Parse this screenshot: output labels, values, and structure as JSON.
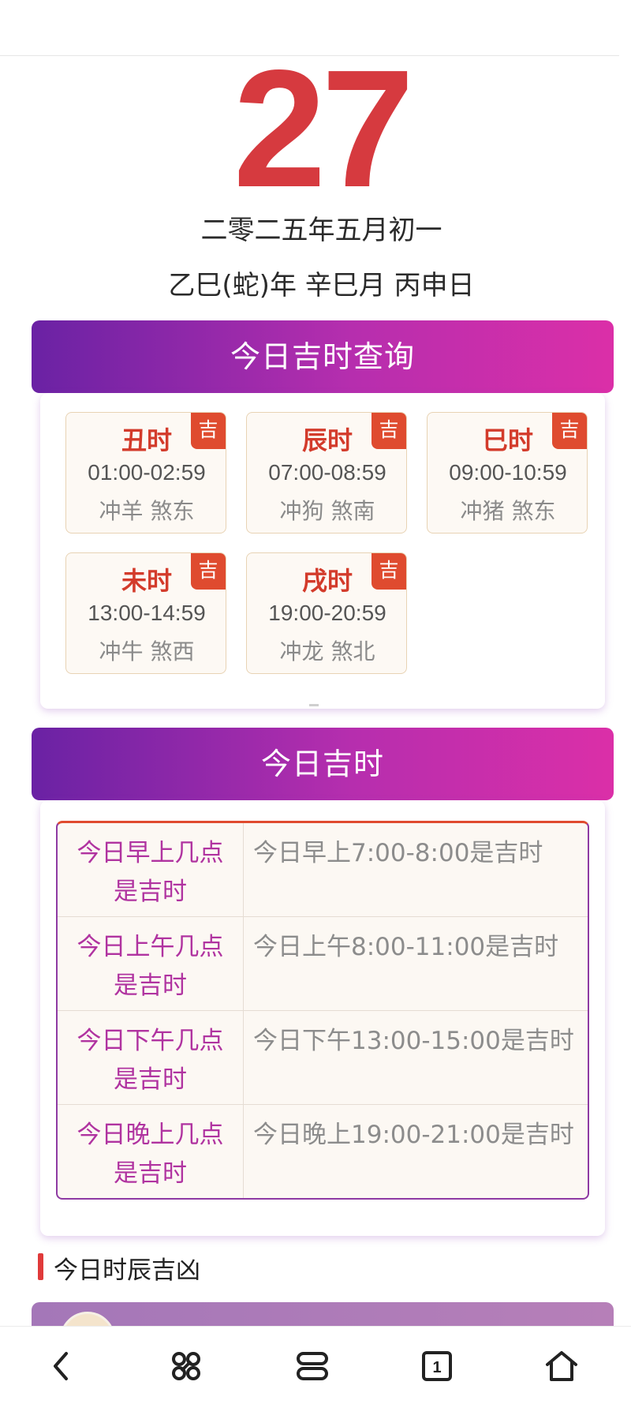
{
  "header": {
    "day": "27",
    "lunar_date": "二零二五年五月初一",
    "ganzhi": "乙巳(蛇)年 辛巳月 丙申日"
  },
  "lucky_hours_query": {
    "title": "今日吉时查询",
    "hours": [
      {
        "name": "丑时",
        "tag": "吉",
        "time": "01:00-02:59",
        "info": "冲羊 煞东"
      },
      {
        "name": "辰时",
        "tag": "吉",
        "time": "07:00-08:59",
        "info": "冲狗 煞南"
      },
      {
        "name": "巳时",
        "tag": "吉",
        "time": "09:00-10:59",
        "info": "冲猪 煞东"
      },
      {
        "name": "未时",
        "tag": "吉",
        "time": "13:00-14:59",
        "info": "冲牛 煞西"
      },
      {
        "name": "戌时",
        "tag": "吉",
        "time": "19:00-20:59",
        "info": "冲龙 煞北"
      }
    ]
  },
  "lucky_today": {
    "title": "今日吉时",
    "rows": [
      {
        "question_line1": "今日早上几点",
        "question_line2": "是吉时",
        "answer": "今日早上7:00-8:00是吉时"
      },
      {
        "question_line1": "今日上午几点",
        "question_line2": "是吉时",
        "answer": "今日上午8:00-11:00是吉时"
      },
      {
        "question_line1": "今日下午几点",
        "question_line2": "是吉时",
        "answer": "今日下午13:00-15:00是吉时"
      },
      {
        "question_line1": "今日晚上几点",
        "question_line2": "是吉时",
        "answer": "今日晚上19:00-21:00是吉时"
      }
    ]
  },
  "section": {
    "title": "今日时辰吉凶"
  },
  "nav": {
    "items": [
      "back-icon",
      "shortcuts-icon",
      "menu-icon",
      "tabs-icon",
      "home-icon"
    ],
    "tab_count": "1"
  },
  "colors": {
    "day": "#d63a3f",
    "banner_start": "#6a22a4",
    "banner_end": "#db2fa8",
    "tag": "#df4b2f",
    "question": "#b033a0"
  }
}
